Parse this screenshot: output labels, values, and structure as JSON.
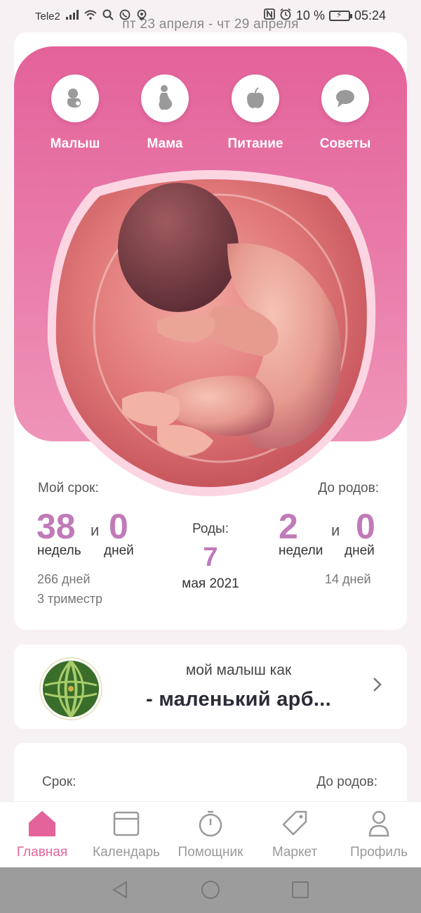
{
  "status_bar": {
    "carrier": "Tele2",
    "battery": "10 %",
    "time": "05:24"
  },
  "date_range": "пт 23 апреля - чт 29 апреля",
  "top_nav": [
    {
      "label": "Малыш",
      "icon": "baby-icon"
    },
    {
      "label": "Мама",
      "icon": "pregnant-mom-icon"
    },
    {
      "label": "Питание",
      "icon": "apple-icon"
    },
    {
      "label": "Советы",
      "icon": "chat-bubble-icon"
    }
  ],
  "stats": {
    "my_term_label": "Мой срок:",
    "until_birth_label": "До родов:",
    "weeks": "38",
    "and1": "и",
    "days": "0",
    "weeks_unit": "недель",
    "days_unit": "дней",
    "total_days": "266 дней",
    "trimester": "3 триместр",
    "birth_label": "Роды:",
    "birth_day": "7",
    "birth_month": "мая 2021",
    "left_weeks": "2",
    "and2": "и",
    "left_days": "0",
    "left_weeks_unit": "недели",
    "left_days_unit": "дней",
    "left_total_days": "14 дней"
  },
  "size_card": {
    "line1": "мой малыш как",
    "line2": "- маленький арб..."
  },
  "lower_card": {
    "term_label": "Срок:",
    "until_label": "До родов:"
  },
  "bottom_nav": [
    {
      "label": "Главная",
      "icon": "home-icon",
      "active": true
    },
    {
      "label": "Календарь",
      "icon": "calendar-icon"
    },
    {
      "label": "Помощник",
      "icon": "stopwatch-icon"
    },
    {
      "label": "Маркет",
      "icon": "tag-icon"
    },
    {
      "label": "Профиль",
      "icon": "profile-icon"
    }
  ],
  "colors": {
    "accent": "#e3629a",
    "number": "#c07ab8"
  }
}
